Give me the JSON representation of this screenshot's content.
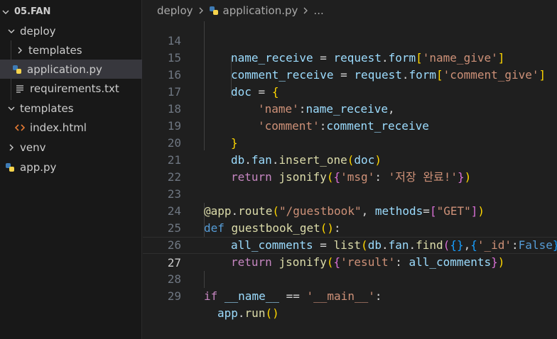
{
  "explorer": {
    "root": "05.FAN",
    "items": [
      {
        "label": "deploy",
        "kind": "folder-open"
      },
      {
        "label": "templates",
        "kind": "folder-closed"
      },
      {
        "label": "application.py",
        "kind": "python"
      },
      {
        "label": "requirements.txt",
        "kind": "text"
      },
      {
        "label": "templates",
        "kind": "folder-open"
      },
      {
        "label": "index.html",
        "kind": "html"
      },
      {
        "label": "venv",
        "kind": "folder-closed"
      },
      {
        "label": "app.py",
        "kind": "python"
      }
    ]
  },
  "breadcrumb": {
    "folder": "deploy",
    "file": "application.py",
    "more": "..."
  },
  "editor": {
    "active_line": "27",
    "line_numbers": [
      "14",
      "15",
      "16",
      "17",
      "18",
      "19",
      "20",
      "21",
      "22",
      "23",
      "24",
      "25",
      "26",
      "27",
      "28",
      "29"
    ],
    "lines": [
      "name_receive = request.form['name_give']",
      "comment_receive = request.form['comment_give']",
      "doc = {",
      "'name':name_receive,",
      "'comment':comment_receive",
      "}",
      "db.fan.insert_one(doc)",
      "return jsonify({'msg': '저장 완료!'})",
      "",
      "@app.route(\"/guestbook\", methods=[\"GET\"])",
      "def guestbook_get():",
      "all_comments = list(db.fan.find({},{'_id':False}))",
      "return jsonify({'result': all_comments})",
      "",
      "if __name__ == '__main__':",
      "app.run()"
    ]
  },
  "colors": {
    "sidebar_bg": "#181818",
    "editor_bg": "#1f1f1f",
    "selection": "#37373d",
    "keyword": "#c586c0",
    "variable": "#9cdcfe",
    "function": "#dcdcaa",
    "string": "#ce9178"
  }
}
